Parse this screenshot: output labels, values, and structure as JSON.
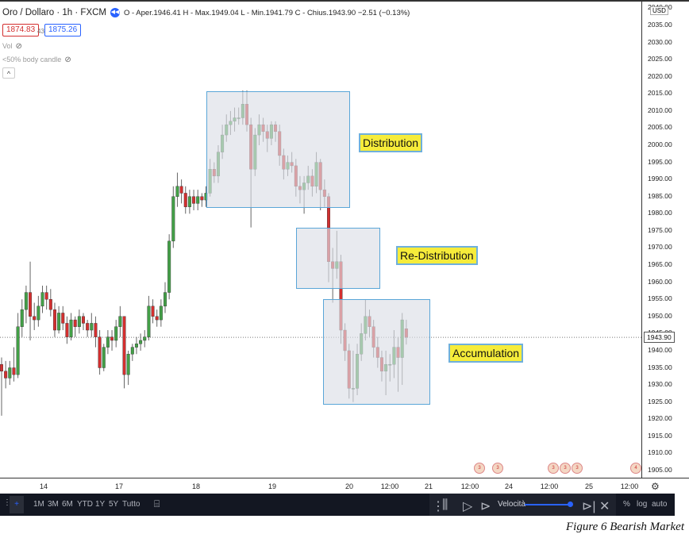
{
  "header": {
    "symbol": "Oro / Dollaro · 1h · FXCM",
    "ohlc": "O - Aper.1946.41 H - Max.1949.04 L - Min.1941.79 C - Chius.1943.90 −2.51 (−0.13%)",
    "bid": "1874.83",
    "spread": "43",
    "ask": "1875.26",
    "indicators": [
      "Vol",
      "<50% body candle"
    ]
  },
  "price_axis": {
    "currency": "USD",
    "ticks": [
      "2040.00",
      "2035.00",
      "2030.00",
      "2025.00",
      "2020.00",
      "2015.00",
      "2010.00",
      "2005.00",
      "2000.00",
      "1995.00",
      "1990.00",
      "1985.00",
      "1980.00",
      "1975.00",
      "1970.00",
      "1965.00",
      "1960.00",
      "1955.00",
      "1950.00",
      "1945.00",
      "1940.00",
      "1935.00",
      "1930.00",
      "1925.00",
      "1920.00",
      "1915.00",
      "1910.00",
      "1905.00"
    ],
    "current_price": "1943.90"
  },
  "time_axis": {
    "labels": [
      "14",
      "17",
      "18",
      "19",
      "20",
      "12:00",
      "21",
      "12:00",
      "24",
      "12:00",
      "25",
      "12:00"
    ]
  },
  "zones": [
    {
      "label": "Distribution"
    },
    {
      "label": "Re-Distribution"
    },
    {
      "label": "Accumulation"
    }
  ],
  "toolbar": {
    "ranges": [
      "1M",
      "3M",
      "6M",
      "YTD",
      "1Y",
      "5Y",
      "Tutto"
    ],
    "speed_label": "Velocità",
    "speed_value": 1.0,
    "right": [
      "%",
      "log",
      "auto"
    ]
  },
  "events": [
    "3",
    "3",
    "3",
    "3",
    "3",
    "4"
  ],
  "caption": "Figure 6 Bearish Market",
  "colors": {
    "up": "#43a047",
    "down": "#d32f2f",
    "zone_border": "#5aa6d8",
    "label_bg": "#f6ec3a"
  },
  "chart_data": {
    "type": "candlestick",
    "ylim": [
      1902,
      2042
    ],
    "candles": [
      [
        1936,
        1938,
        1921,
        1934
      ],
      [
        1934,
        1937,
        1929,
        1932
      ],
      [
        1932,
        1937,
        1930,
        1935
      ],
      [
        1935,
        1941,
        1931,
        1933
      ],
      [
        1933,
        1951,
        1932,
        1947
      ],
      [
        1947,
        1955,
        1944,
        1952
      ],
      [
        1952,
        1959,
        1948,
        1957
      ],
      [
        1957,
        1966,
        1943,
        1950
      ],
      [
        1950,
        1954,
        1946,
        1949
      ],
      [
        1949,
        1956,
        1947,
        1953
      ],
      [
        1953,
        1959,
        1951,
        1957
      ],
      [
        1957,
        1959,
        1952,
        1955
      ],
      [
        1955,
        1958,
        1950,
        1952
      ],
      [
        1952,
        1954,
        1944,
        1946
      ],
      [
        1946,
        1953,
        1945,
        1951
      ],
      [
        1951,
        1953,
        1946,
        1948
      ],
      [
        1948,
        1950,
        1942,
        1944
      ],
      [
        1944,
        1951,
        1943,
        1949
      ],
      [
        1949,
        1950,
        1944,
        1947
      ],
      [
        1947,
        1952,
        1945,
        1950
      ],
      [
        1950,
        1951,
        1946,
        1948
      ],
      [
        1948,
        1949,
        1944,
        1946
      ],
      [
        1946,
        1951,
        1944,
        1948
      ],
      [
        1948,
        1950,
        1941,
        1944
      ],
      [
        1944,
        1946,
        1933,
        1935
      ],
      [
        1935,
        1942,
        1934,
        1941
      ],
      [
        1941,
        1946,
        1939,
        1944
      ],
      [
        1944,
        1946,
        1940,
        1943
      ],
      [
        1943,
        1949,
        1941,
        1947
      ],
      [
        1947,
        1953,
        1944,
        1950
      ],
      [
        1950,
        1950,
        1929,
        1933
      ],
      [
        1933,
        1940,
        1930,
        1939
      ],
      [
        1939,
        1942,
        1937,
        1941
      ],
      [
        1941,
        1944,
        1939,
        1942
      ],
      [
        1942,
        1945,
        1940,
        1943
      ],
      [
        1943,
        1946,
        1941,
        1944
      ],
      [
        1944,
        1956,
        1943,
        1953
      ],
      [
        1953,
        1955,
        1948,
        1950
      ],
      [
        1950,
        1952,
        1947,
        1949
      ],
      [
        1949,
        1955,
        1947,
        1953
      ],
      [
        1953,
        1960,
        1951,
        1957
      ],
      [
        1957,
        1974,
        1955,
        1972
      ],
      [
        1972,
        1988,
        1970,
        1985
      ],
      [
        1985,
        1992,
        1982,
        1988
      ],
      [
        1988,
        1990,
        1983,
        1986
      ],
      [
        1986,
        1988,
        1980,
        1982
      ],
      [
        1982,
        1987,
        1980,
        1985
      ],
      [
        1985,
        1987,
        1981,
        1983
      ],
      [
        1983,
        1987,
        1981,
        1985
      ],
      [
        1985,
        1986,
        1982,
        1984
      ],
      [
        1984,
        1988,
        1982,
        1986
      ],
      [
        1986,
        1996,
        1985,
        1993
      ],
      [
        1993,
        1995,
        1989,
        1991
      ],
      [
        1991,
        2000,
        1989,
        1998
      ],
      [
        1998,
        2006,
        1996,
        2003
      ],
      [
        2003,
        2009,
        2001,
        2006
      ],
      [
        2006,
        2010,
        2003,
        2007
      ],
      [
        2007,
        2011,
        2004,
        2008
      ],
      [
        2008,
        2011,
        2006,
        2008
      ],
      [
        2008,
        2016,
        2006,
        2012
      ],
      [
        2012,
        2016,
        2004,
        2006
      ],
      [
        2006,
        2008,
        1976,
        1993
      ],
      [
        1993,
        2005,
        1991,
        2003
      ],
      [
        2003,
        2009,
        2000,
        2006
      ],
      [
        2006,
        2008,
        2001,
        2004
      ],
      [
        2004,
        2006,
        1998,
        2002
      ],
      [
        2002,
        2007,
        2000,
        2006
      ],
      [
        2006,
        2007,
        2001,
        2004
      ],
      [
        2004,
        2006,
        1994,
        1997
      ],
      [
        1997,
        1999,
        1990,
        1993
      ],
      [
        1993,
        1997,
        1991,
        1995
      ],
      [
        1995,
        1998,
        1992,
        1994
      ],
      [
        1994,
        1996,
        1985,
        1988
      ],
      [
        1988,
        1991,
        1983,
        1987
      ],
      [
        1987,
        1991,
        1980,
        1989
      ],
      [
        1989,
        1994,
        1987,
        1991
      ],
      [
        1991,
        1993,
        1985,
        1988
      ],
      [
        1988,
        1998,
        1986,
        1995
      ],
      [
        1995,
        1996,
        1981,
        1987
      ],
      [
        1987,
        1990,
        1982,
        1985
      ],
      [
        1985,
        1986,
        1960,
        1966
      ],
      [
        1966,
        1970,
        1954,
        1964
      ],
      [
        1964,
        1975,
        1961,
        1966
      ],
      [
        1966,
        1968,
        1942,
        1946
      ],
      [
        1946,
        1948,
        1937,
        1940
      ],
      [
        1940,
        1942,
        1926,
        1929
      ],
      [
        1929,
        1940,
        1925,
        1929
      ],
      [
        1929,
        1942,
        1927,
        1939
      ],
      [
        1939,
        1948,
        1937,
        1945
      ],
      [
        1945,
        1955,
        1943,
        1950
      ],
      [
        1950,
        1952,
        1944,
        1947
      ],
      [
        1947,
        1949,
        1938,
        1941
      ],
      [
        1941,
        1944,
        1935,
        1938
      ],
      [
        1938,
        1940,
        1931,
        1934
      ],
      [
        1934,
        1940,
        1927,
        1936
      ],
      [
        1936,
        1939,
        1931,
        1936
      ],
      [
        1936,
        1946,
        1932,
        1941
      ],
      [
        1941,
        1944,
        1928,
        1938
      ],
      [
        1938,
        1951,
        1930,
        1949
      ],
      [
        1946.41,
        1949.04,
        1941.79,
        1943.9
      ]
    ]
  }
}
